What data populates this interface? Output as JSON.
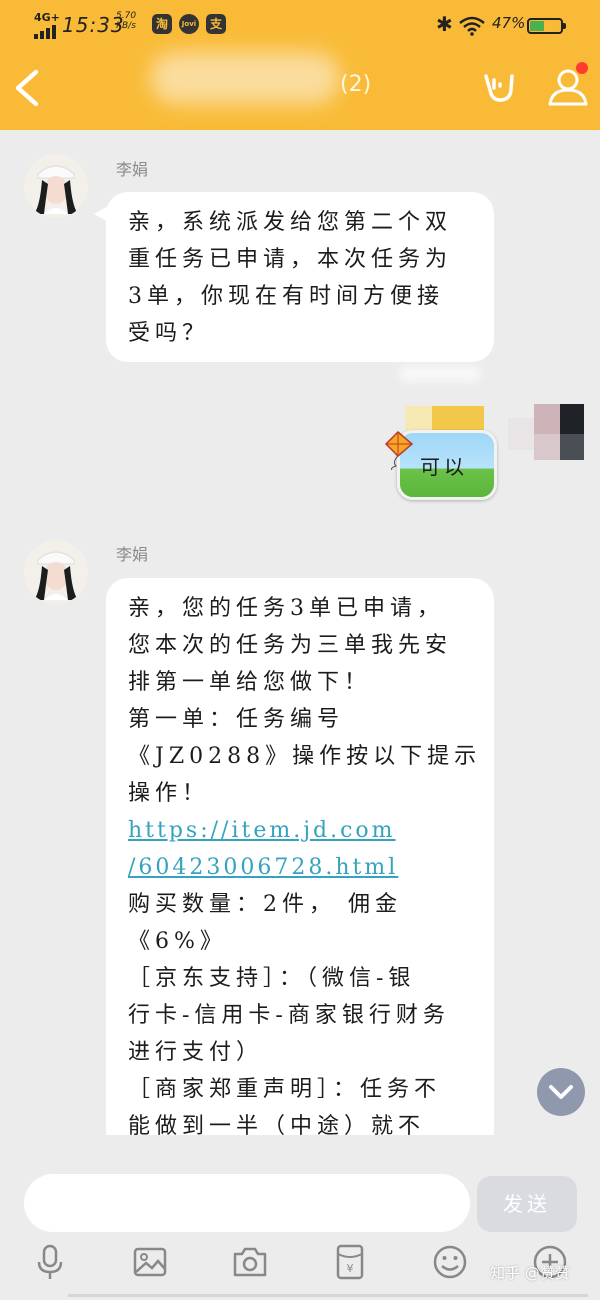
{
  "status_bar": {
    "network": "4G+",
    "time": "15:33",
    "speed_value": "5.70",
    "speed_unit": "KB/s",
    "app_icons": [
      "淘",
      "Jovi",
      "支"
    ],
    "battery_percent": "47%",
    "battery_level": 0.47,
    "colors": {
      "battery_fill": "#4caf50"
    }
  },
  "header": {
    "title_suffix": "(2)",
    "background": "#f9bb37"
  },
  "messages": [
    {
      "sender": "李娟",
      "side": "left",
      "lines": [
        "亲，系统派发给您第二个双",
        "重任务已申请，本次任务为",
        "3单，你现在有时间方便接",
        "受吗？"
      ]
    },
    {
      "side": "right",
      "text": "可以"
    },
    {
      "sender": "李娟",
      "side": "left",
      "lines": [
        "亲，您的任务3单已申请，",
        "您本次的任务为三单我先安",
        "排第一单给您做下！",
        "第一单：任务编号",
        "《JZ0288》操作按以下提示",
        "操作！",
        "https://item.jd.com",
        "/60423006728.html",
        "购买数量：2件，  佣金",
        "《6%》",
        "［京东支持］：（微信-银",
        "行卡-信用卡-商家银行财务",
        "进行支付）",
        "［商家郑重声明］：任务不",
        "能做到一半（中途）就不"
      ],
      "link_line_indexes": [
        6,
        7
      ]
    }
  ],
  "input_bar": {
    "placeholder": "",
    "send_label": "发送"
  },
  "toolbar_icons": [
    "microphone-icon",
    "image-icon",
    "camera-icon",
    "red-packet-icon",
    "emoji-icon",
    "plus-icon"
  ],
  "watermark": "知乎 @赞赞"
}
